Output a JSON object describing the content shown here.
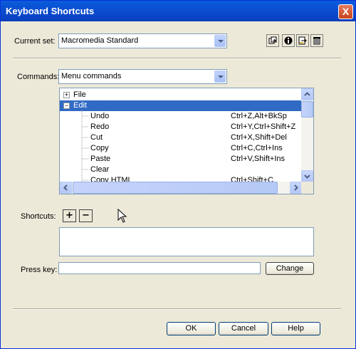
{
  "window": {
    "title": "Keyboard Shortcuts",
    "close_label": "X"
  },
  "current_set": {
    "label": "Current set:",
    "value": "Macromedia Standard"
  },
  "commands": {
    "label": "Commands:",
    "value": "Menu commands"
  },
  "tree": {
    "items": [
      {
        "name": "File",
        "keys": "",
        "expander": "+",
        "level": 0,
        "selected": false
      },
      {
        "name": "Edit",
        "keys": "",
        "expander": "−",
        "level": 0,
        "selected": true
      },
      {
        "name": "Undo",
        "keys": "Ctrl+Z,Alt+BkSp",
        "level": 1,
        "selected": false
      },
      {
        "name": "Redo",
        "keys": "Ctrl+Y,Ctrl+Shift+Z",
        "level": 1,
        "selected": false
      },
      {
        "name": "Cut",
        "keys": "Ctrl+X,Shift+Del",
        "level": 1,
        "selected": false
      },
      {
        "name": "Copy",
        "keys": "Ctrl+C,Ctrl+Ins",
        "level": 1,
        "selected": false
      },
      {
        "name": "Paste",
        "keys": "Ctrl+V,Shift+Ins",
        "level": 1,
        "selected": false
      },
      {
        "name": "Clear",
        "keys": "",
        "level": 1,
        "selected": false
      },
      {
        "name": "Copy HTML",
        "keys": "Ctrl+Shift+C",
        "level": 1,
        "selected": false
      }
    ]
  },
  "shortcuts": {
    "label": "Shortcuts:",
    "add_label": "+",
    "remove_label": "−"
  },
  "press_key": {
    "label": "Press key:",
    "value": "",
    "change_label": "Change"
  },
  "footer": {
    "ok_label": "OK",
    "cancel_label": "Cancel",
    "help_label": "Help"
  }
}
